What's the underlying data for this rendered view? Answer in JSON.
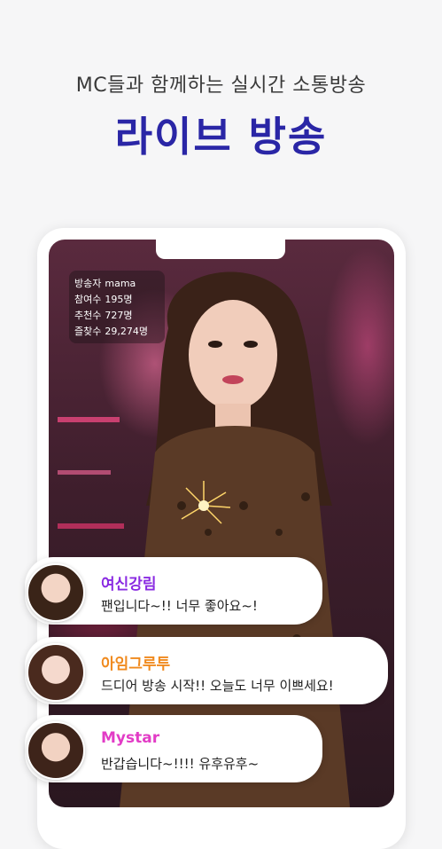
{
  "header": {
    "subtitle": "MC들과 함께하는 실시간 소통방송",
    "title": "라이브 방송"
  },
  "stream_info": {
    "broadcaster_label": "방송자",
    "broadcaster_value": "mama",
    "viewers_label": "참여수",
    "viewers_value": "195명",
    "recommend_label": "추천수",
    "recommend_value": "727명",
    "favorites_label": "즐찾수",
    "favorites_value": "29,274명"
  },
  "colors": {
    "title": "#2a26a6",
    "name1": "#8a2be2",
    "name2": "#f08a1e",
    "name3": "#e23cc6"
  },
  "chats": [
    {
      "name": "여신강림",
      "message": "팬입니다~!! 너무 좋아요~!"
    },
    {
      "name": "아임그루투",
      "message": "드디어 방송 시작!! 오늘도 너무 이쁘세요!"
    },
    {
      "name": "Mystar",
      "message": "반갑습니다~!!!! 유후유후~"
    }
  ]
}
